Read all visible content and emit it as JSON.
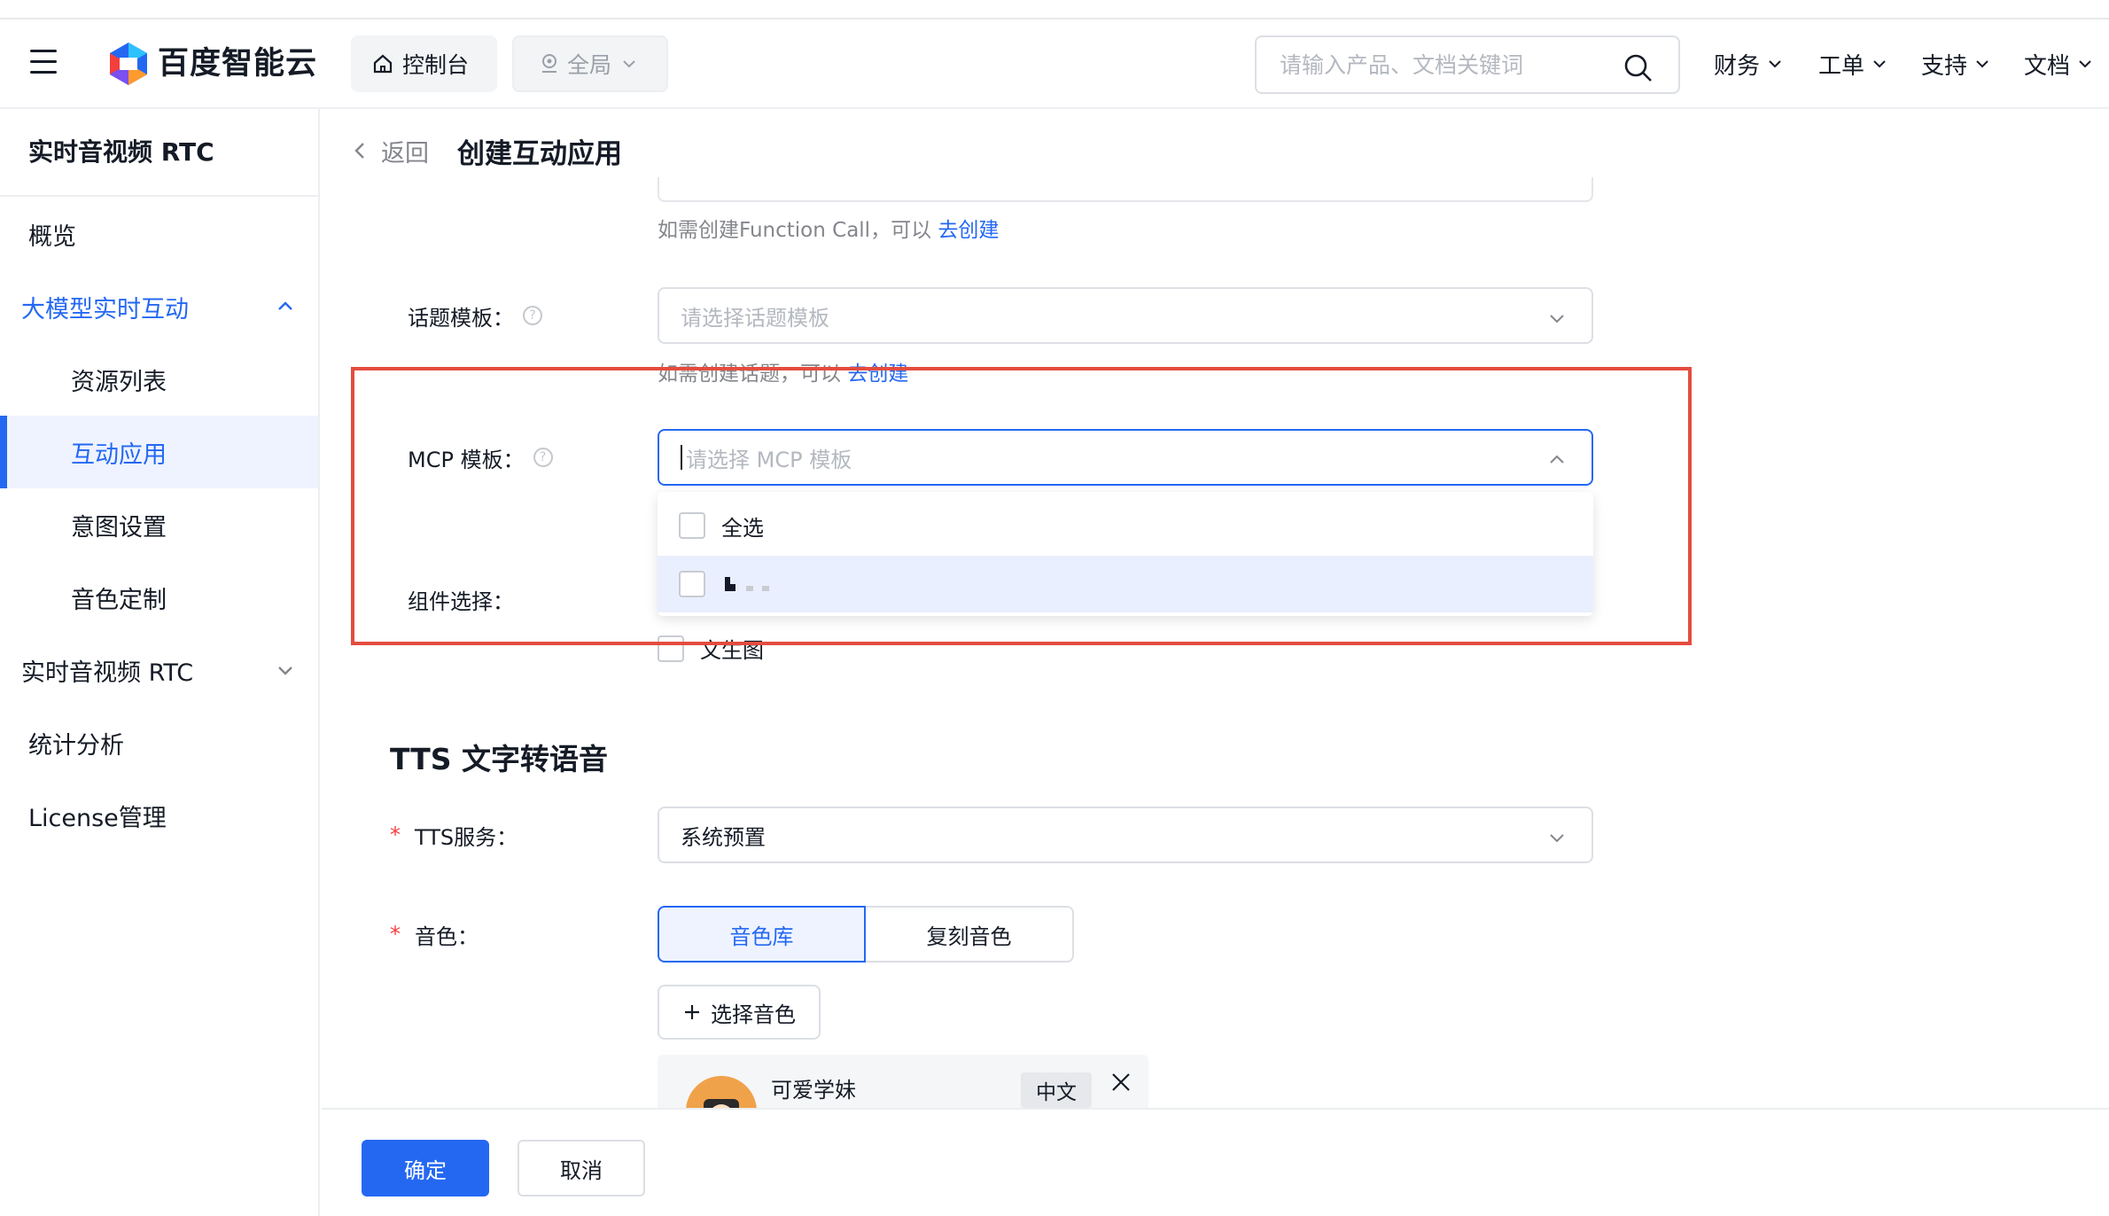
{
  "header": {
    "brand": "百度智能云",
    "console_label": "控制台",
    "region_label": "全局",
    "search_placeholder": "请输入产品、文档关键词",
    "nav": [
      "财务",
      "工单",
      "支持",
      "文档"
    ]
  },
  "sidebar": {
    "title": "实时音视频 RTC",
    "items": [
      {
        "label": "概览"
      },
      {
        "label": "大模型实时互动"
      },
      {
        "label": "资源列表"
      },
      {
        "label": "互动应用"
      },
      {
        "label": "意图设置"
      },
      {
        "label": "音色定制"
      },
      {
        "label": "实时音视频 RTC"
      },
      {
        "label": "统计分析"
      },
      {
        "label": "License管理"
      }
    ]
  },
  "breadcrumb": {
    "back": "返回",
    "title": "创建互动应用"
  },
  "form": {
    "function_call_help": "如需创建Function Call，可以",
    "function_call_link": "去创建",
    "topic_label": "话题模板：",
    "topic_placeholder": "请选择话题模板",
    "topic_help": "如需创建话题，可以",
    "topic_link": "去创建",
    "mcp_label": "MCP 模板：",
    "mcp_placeholder": "请选择 MCP 模板",
    "mcp_options": [
      "全选",
      ""
    ],
    "component_label": "组件选择：",
    "component_option": "文生图",
    "tts_section": "TTS 文字转语音",
    "tts_service_label": "TTS服务：",
    "tts_service_value": "系统预置",
    "voice_label": "音色：",
    "voice_tabs": [
      "音色库",
      "复刻音色"
    ],
    "choose_voice": "选择音色",
    "voice_name": "可爱学妹",
    "voice_lang": "中文"
  },
  "footer": {
    "confirm": "确定",
    "cancel": "取消"
  },
  "colors": {
    "accent": "#2468f2",
    "highlight_box": "#e44c3e",
    "hover_bg": "#e9effe"
  }
}
